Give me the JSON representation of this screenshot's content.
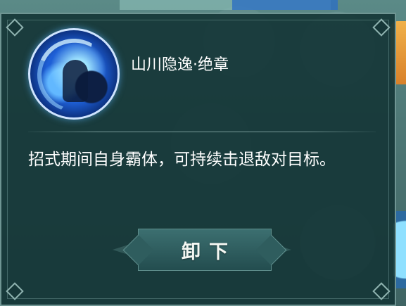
{
  "skill": {
    "title": "山川隐逸·绝章",
    "description": "招式期间自身霸体，可持续击退敌对目标。"
  },
  "actions": {
    "unload_label": "卸下"
  },
  "icons": {
    "skill_icon": "blue-swordsman-portrait-icon"
  },
  "colors": {
    "panel_bg": "#163738",
    "button_bg": "#2f5d5e",
    "text": "#ffffff"
  }
}
